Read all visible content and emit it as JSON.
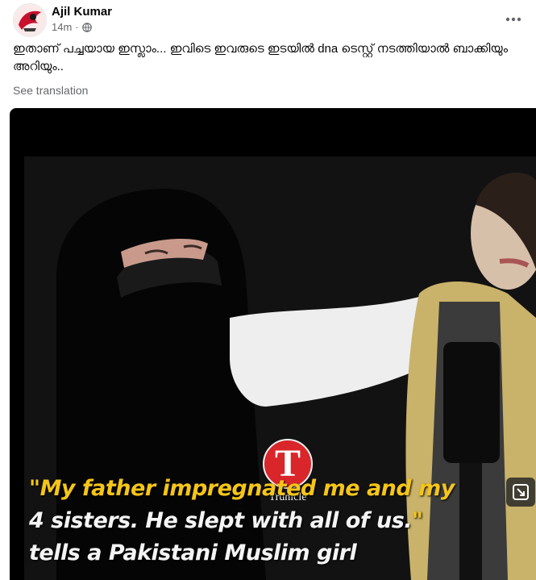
{
  "post": {
    "author": "Ajil Kumar",
    "time": "14m",
    "privacy_icon": "globe-icon",
    "text": "ഇതാണ് പച്ചയായ ഇസ്ലാം... ഇവിടെ ഇവരുടെ ഇടയിൽ dna ടെസ്റ്റ് നടത്തിയാൽ ബാക്കിയും അറിയും..",
    "see_translation": "See translation",
    "more_icon": "more-horizontal-icon"
  },
  "video": {
    "brand_letter": "T",
    "brand_name": "Trunicle",
    "caption": {
      "line1": "\"My father impregnated me and my",
      "line2_text": "4 sisters. He slept with all of us.",
      "line2_quote": "\"",
      "line3": "tells a Pakistani Muslim girl"
    },
    "expand_icon": "expand-icon"
  }
}
